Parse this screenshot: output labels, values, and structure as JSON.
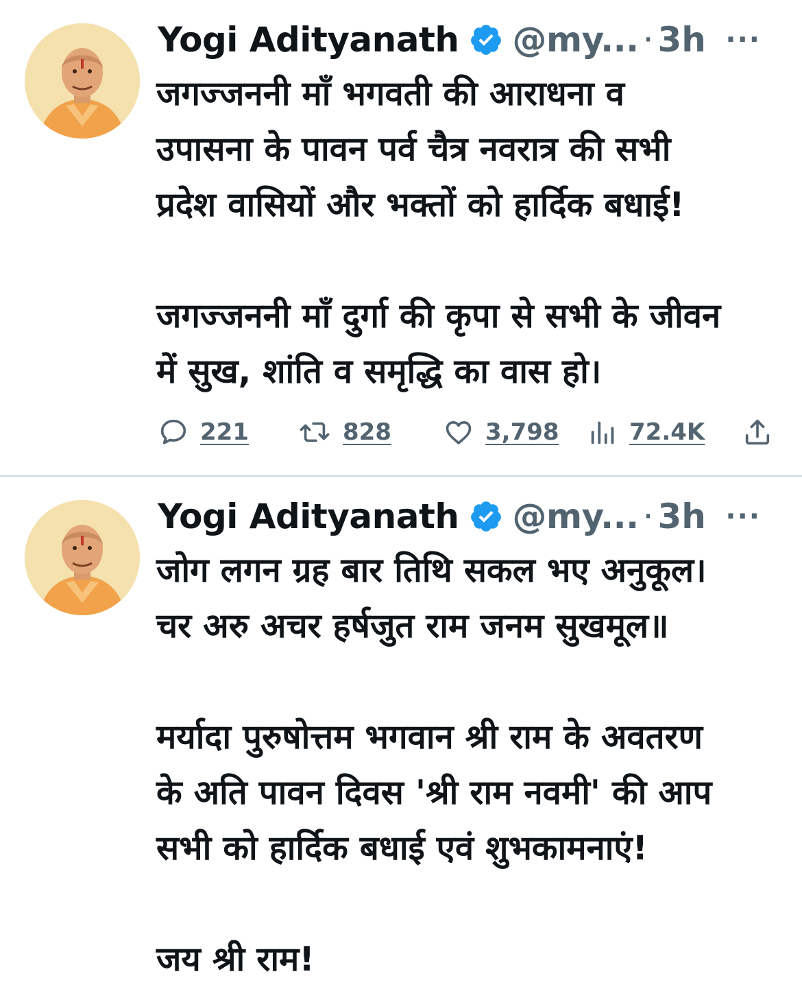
{
  "colors": {
    "text_primary": "#0f1419",
    "text_secondary": "#536471",
    "verified_badge": "#1d9bf0",
    "divider": "#cfd9de",
    "avatar_background": "#f3dda6"
  },
  "tweets": [
    {
      "author": {
        "name": "Yogi Adityanath",
        "handle": "@my...",
        "verified": true
      },
      "separator": "·",
      "time": "3h",
      "more_label": "···",
      "text_lines": [
        "जगज्जननी माँ भगवती की आराधना व",
        "उपासना के पावन पर्व चैत्र नवरात्र की सभी",
        "प्रदेश वासियों और भक्तों को हार्दिक बधाई!",
        "",
        "जगज्जननी माँ दुर्गा की कृपा से सभी के जीवन",
        "में सुख, शांति व समृद्धि का वास हो।"
      ],
      "actions": {
        "replies": "221",
        "retweets": "828",
        "likes": "3,798",
        "views": "72.4K"
      }
    },
    {
      "author": {
        "name": "Yogi Adityanath",
        "handle": "@my...",
        "verified": true
      },
      "separator": "·",
      "time": "3h",
      "more_label": "···",
      "text_lines": [
        "जोग लगन ग्रह बार तिथि सकल भए अनुकूल।",
        "चर अरु अचर हर्षजुत राम जनम सुखमूल॥",
        "",
        "मर्यादा पुरुषोत्तम भगवान श्री राम के अवतरण",
        "के अति पावन दिवस 'श्री राम नवमी' की आप",
        "सभी को हार्दिक बधाई एवं शुभकामनाएं!",
        "",
        "जय श्री राम!"
      ]
    }
  ]
}
